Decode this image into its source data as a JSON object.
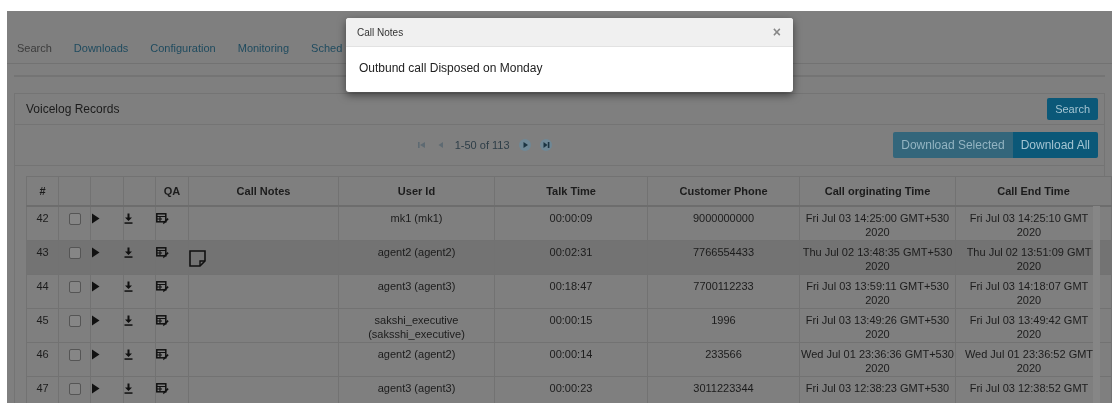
{
  "tabs": [
    {
      "label": "Search",
      "selected": true
    },
    {
      "label": "Downloads",
      "selected": false
    },
    {
      "label": "Configuration",
      "selected": false
    },
    {
      "label": "Monitoring",
      "selected": false
    },
    {
      "label": "Sched",
      "selected": false
    }
  ],
  "panel": {
    "title": "Voicelog Records",
    "search_button": "Search"
  },
  "pager": {
    "range": "1-50 of 113",
    "controls": [
      {
        "kind": "first",
        "disabled": true
      },
      {
        "kind": "previous",
        "disabled": true
      },
      {
        "kind": "next",
        "disabled": false
      },
      {
        "kind": "last",
        "disabled": false
      }
    ]
  },
  "download_buttons": [
    {
      "label": "Download Selected",
      "disabled": true
    },
    {
      "label": "Download All",
      "disabled": false
    }
  ],
  "table": {
    "columns": [
      {
        "label": "#"
      },
      {},
      {},
      {},
      {
        "label": "QA"
      },
      {
        "label": "Call Notes"
      },
      {
        "label": "User Id"
      },
      {
        "label": "Talk Time"
      },
      {
        "label": "Customer Phone"
      },
      {
        "label": "Call orginating Time"
      },
      {
        "label": "Call End Time"
      }
    ],
    "rows": [
      {
        "number": "42",
        "checked": false,
        "has_note": false,
        "highlighted": false,
        "user_id": "mk1 (mk1)",
        "talk_time": "00:00:09",
        "customer_phone": "9000000000",
        "call_originating_time": "Fri Jul 03 14:25:00 GMT+530\n2020",
        "call_end_time": "Fri Jul 03 14:25:10 GMT\n2020"
      },
      {
        "number": "43",
        "checked": false,
        "has_note": true,
        "highlighted": true,
        "user_id": "agent2 (agent2)",
        "talk_time": "00:02:31",
        "customer_phone": "7766554433",
        "call_originating_time": "Thu Jul 02 13:48:35 GMT+530\n2020",
        "call_end_time": "Thu Jul 02 13:51:09 GMT\n2020"
      },
      {
        "number": "44",
        "checked": false,
        "has_note": false,
        "highlighted": false,
        "user_id": "agent3 (agent3)",
        "talk_time": "00:18:47",
        "customer_phone": "7700112233",
        "call_originating_time": "Fri Jul 03 13:59:11 GMT+530\n2020",
        "call_end_time": "Fri Jul 03 14:18:07 GMT\n2020"
      },
      {
        "number": "45",
        "checked": false,
        "has_note": false,
        "highlighted": false,
        "user_id": "sakshi_executive\n(saksshi_executive)",
        "talk_time": "00:00:15",
        "customer_phone": "1996",
        "call_originating_time": "Fri Jul 03 13:49:26 GMT+530\n2020",
        "call_end_time": "Fri Jul 03 13:49:42 GMT\n2020"
      },
      {
        "number": "46",
        "checked": false,
        "has_note": false,
        "highlighted": false,
        "user_id": "agent2 (agent2)",
        "talk_time": "00:00:14",
        "customer_phone": "233566",
        "call_originating_time": "Wed Jul 01 23:36:36 GMT+530\n2020",
        "call_end_time": "Wed Jul 01 23:36:52 GMT\n2020"
      },
      {
        "number": "47",
        "checked": false,
        "has_note": false,
        "highlighted": false,
        "user_id": "agent3 (agent3)",
        "talk_time": "00:00:23",
        "customer_phone": "3011223344",
        "call_originating_time": "Fri Jul 03 12:38:23 GMT+530",
        "call_end_time": "Fri Jul 03 12:38:52 GMT"
      }
    ]
  },
  "modal": {
    "title": "Call Notes",
    "close": "×",
    "body": "Outbund call Disposed on Monday"
  }
}
